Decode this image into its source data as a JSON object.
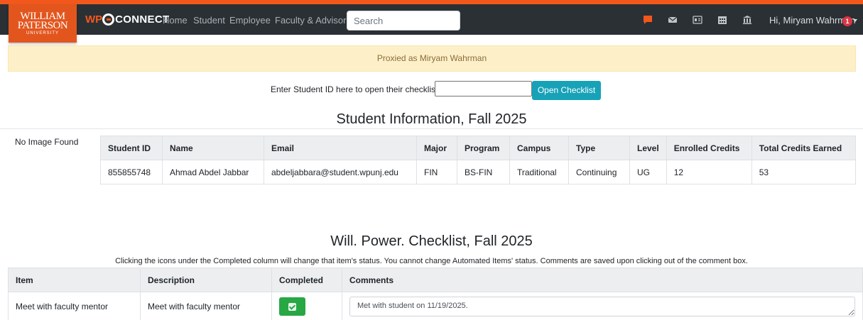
{
  "logo": {
    "line1": "WILLIAM",
    "line2": "PATERSON",
    "line3": "UNIVERSITY"
  },
  "brand": {
    "prefix": "WP",
    "name": "CONNECT"
  },
  "nav": {
    "links": [
      "Home",
      "Student",
      "Employee",
      "Faculty & Advisors"
    ],
    "search_placeholder": "Search",
    "icons": [
      "chat-icon",
      "mail-icon",
      "id-card-icon",
      "calendar-icon",
      "bank-icon"
    ],
    "user_greeting": "Hi, Miryam Wahrman",
    "notification_count": "1"
  },
  "colors": {
    "accent": "#f2581b",
    "navbar": "#2b3035",
    "info_button": "#17a2b8",
    "success": "#28a745",
    "alert_bg": "#fdf0c9"
  },
  "proxy_banner": "Proxied as Miryam Wahrman",
  "lookup": {
    "label": "Enter Student ID here to open their checklist:",
    "input_value": "",
    "button": "Open Checklist"
  },
  "student_info": {
    "title": "Student Information, Fall 2025",
    "no_image": "No Image Found",
    "headers": [
      "Student ID",
      "Name",
      "Email",
      "Major",
      "Program",
      "Campus",
      "Type",
      "Level",
      "Enrolled Credits",
      "Total Credits Earned"
    ],
    "row": [
      "855855748",
      "Ahmad Abdel Jabbar",
      "abdeljabbara@student.wpunj.edu",
      "FIN",
      "BS-FIN",
      "Traditional",
      "Continuing",
      "UG",
      "12",
      "53"
    ]
  },
  "checklist": {
    "title": "Will. Power. Checklist, Fall 2025",
    "instructions": "Clicking the icons under the Completed column will change that item's status. You cannot change Automated Items' status. Comments are saved upon clicking out of the comment box.",
    "headers": [
      "Item",
      "Description",
      "Completed",
      "Comments"
    ],
    "rows": [
      {
        "item": "Meet with faculty mentor",
        "description": "Meet with faculty mentor",
        "completed": true,
        "comment": "Met with student on 11/19/2025."
      }
    ]
  }
}
